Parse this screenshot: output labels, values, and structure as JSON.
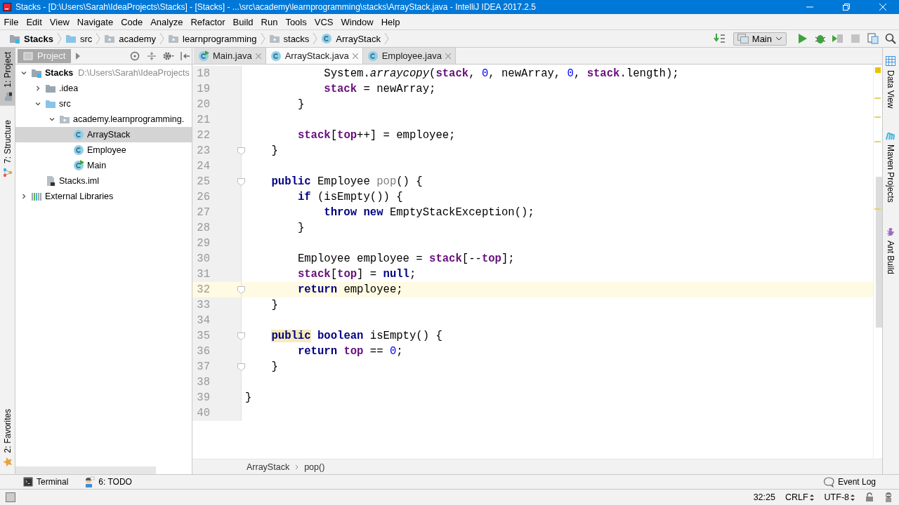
{
  "window": {
    "title": "Stacks - [D:\\Users\\Sarah\\IdeaProjects\\Stacks] - [Stacks] - ...\\src\\academy\\learnprogramming\\stacks\\ArrayStack.java - IntelliJ IDEA 2017.2.5"
  },
  "menu": [
    "File",
    "Edit",
    "View",
    "Navigate",
    "Code",
    "Analyze",
    "Refactor",
    "Build",
    "Run",
    "Tools",
    "VCS",
    "Window",
    "Help"
  ],
  "navigation": {
    "crumbs": [
      {
        "label": "Stacks",
        "kind": "project"
      },
      {
        "label": "src",
        "kind": "source-folder"
      },
      {
        "label": "academy",
        "kind": "package"
      },
      {
        "label": "learnprogramming",
        "kind": "package"
      },
      {
        "label": "stacks",
        "kind": "package"
      },
      {
        "label": "ArrayStack",
        "kind": "class"
      }
    ],
    "run_config": "Main"
  },
  "left_tool_windows": [
    {
      "label": "1: Project",
      "kind": "project",
      "selected": true
    },
    {
      "label": "7: Structure",
      "kind": "structure",
      "selected": false
    }
  ],
  "left_bottom_tool_windows": [
    {
      "label": "2: Favorites",
      "kind": "favorites",
      "selected": false
    }
  ],
  "project_panel": {
    "title": "Project",
    "tree": [
      {
        "label": "Stacks",
        "detail": "D:\\Users\\Sarah\\IdeaProjects",
        "kind": "project",
        "expanded": true,
        "selected": false,
        "children": [
          {
            "label": ".idea",
            "kind": "folder",
            "expanded": false,
            "selected": false
          },
          {
            "label": "src",
            "kind": "source-folder",
            "expanded": true,
            "selected": false,
            "children": [
              {
                "label": "academy.learnprogramming.",
                "kind": "package",
                "expanded": true,
                "selected": false,
                "children": [
                  {
                    "label": "ArrayStack",
                    "kind": "class",
                    "selected": true
                  },
                  {
                    "label": "Employee",
                    "kind": "class",
                    "selected": false
                  },
                  {
                    "label": "Main",
                    "kind": "main-class",
                    "selected": false
                  }
                ]
              }
            ]
          },
          {
            "label": "Stacks.iml",
            "kind": "file",
            "selected": false
          }
        ]
      },
      {
        "label": "External Libraries",
        "kind": "libraries",
        "expanded": false,
        "selected": false
      }
    ]
  },
  "editor": {
    "tabs": [
      {
        "label": "Main.java",
        "kind": "main-class",
        "selected": false
      },
      {
        "label": "ArrayStack.java",
        "kind": "class",
        "selected": true
      },
      {
        "label": "Employee.java",
        "kind": "class",
        "selected": false
      }
    ],
    "lines": [
      {
        "number": "18",
        "current": false,
        "fold": false,
        "tokens": [
          {
            "text": "            System.",
            "kind": "plain"
          },
          {
            "text": "arraycopy",
            "kind": "static"
          },
          {
            "text": "(",
            "kind": "plain"
          },
          {
            "text": "stack",
            "kind": "field"
          },
          {
            "text": ", ",
            "kind": "plain"
          },
          {
            "text": "0",
            "kind": "num"
          },
          {
            "text": ", newArray, ",
            "kind": "plain"
          },
          {
            "text": "0",
            "kind": "num"
          },
          {
            "text": ", ",
            "kind": "plain"
          },
          {
            "text": "stack",
            "kind": "field"
          },
          {
            "text": ".length);",
            "kind": "plain"
          }
        ]
      },
      {
        "number": "19",
        "current": false,
        "fold": false,
        "tokens": [
          {
            "text": "            stack",
            "kind": "field"
          },
          {
            "text": " = newArray;",
            "kind": "plain"
          }
        ]
      },
      {
        "number": "20",
        "current": false,
        "fold": false,
        "tokens": [
          {
            "text": "        }",
            "kind": "plain"
          }
        ]
      },
      {
        "number": "21",
        "current": false,
        "fold": false
      },
      {
        "number": "22",
        "current": false,
        "fold": false,
        "tokens": [
          {
            "text": "        stack",
            "kind": "field"
          },
          {
            "text": "[",
            "kind": "plain"
          },
          {
            "text": "top",
            "kind": "field"
          },
          {
            "text": "++] = employee;",
            "kind": "plain"
          }
        ]
      },
      {
        "number": "23",
        "current": false,
        "fold": true,
        "tokens": [
          {
            "text": "    }",
            "kind": "plain"
          }
        ]
      },
      {
        "number": "24",
        "current": false,
        "fold": false
      },
      {
        "number": "25",
        "current": false,
        "fold": true,
        "tokens": [
          {
            "text": "    public",
            "kind": "kw"
          },
          {
            "text": " Employee ",
            "kind": "plain"
          },
          {
            "text": "pop",
            "kind": "dim"
          },
          {
            "text": "() {",
            "kind": "plain"
          }
        ]
      },
      {
        "number": "26",
        "current": false,
        "fold": false,
        "tokens": [
          {
            "text": "        if",
            "kind": "kw"
          },
          {
            "text": " (isEmpty()) {",
            "kind": "plain"
          }
        ]
      },
      {
        "number": "27",
        "current": false,
        "fold": false,
        "tokens": [
          {
            "text": "            throw new",
            "kind": "kw"
          },
          {
            "text": " EmptyStackException();",
            "kind": "plain"
          }
        ]
      },
      {
        "number": "28",
        "current": false,
        "fold": false,
        "tokens": [
          {
            "text": "        }",
            "kind": "plain"
          }
        ]
      },
      {
        "number": "29",
        "current": false,
        "fold": false
      },
      {
        "number": "30",
        "current": false,
        "fold": false,
        "tokens": [
          {
            "text": "        Employee employee = ",
            "kind": "plain"
          },
          {
            "text": "stack",
            "kind": "field"
          },
          {
            "text": "[--",
            "kind": "plain"
          },
          {
            "text": "top",
            "kind": "field"
          },
          {
            "text": "];",
            "kind": "plain"
          }
        ]
      },
      {
        "number": "31",
        "current": false,
        "fold": false,
        "tokens": [
          {
            "text": "        stack",
            "kind": "field"
          },
          {
            "text": "[",
            "kind": "plain"
          },
          {
            "text": "top",
            "kind": "field"
          },
          {
            "text": "] = ",
            "kind": "plain"
          },
          {
            "text": "null",
            "kind": "kw"
          },
          {
            "text": ";",
            "kind": "plain"
          }
        ]
      },
      {
        "number": "32",
        "current": true,
        "fold": true,
        "tokens": [
          {
            "text": "        return",
            "kind": "kw"
          },
          {
            "text": " employee;",
            "kind": "plain"
          }
        ]
      },
      {
        "number": "33",
        "current": false,
        "fold": false,
        "tokens": [
          {
            "text": "    }",
            "kind": "plain"
          }
        ]
      },
      {
        "number": "34",
        "current": false,
        "fold": false
      },
      {
        "number": "35",
        "current": false,
        "fold": true,
        "tokens": [
          {
            "text": "    public",
            "kind": "kw-hl"
          },
          {
            "text": " boolean",
            "kind": "kw"
          },
          {
            "text": " isEmpty() {",
            "kind": "plain"
          }
        ]
      },
      {
        "number": "36",
        "current": false,
        "fold": false,
        "tokens": [
          {
            "text": "        return ",
            "kind": "kw"
          },
          {
            "text": "top",
            "kind": "field"
          },
          {
            "text": " == ",
            "kind": "plain"
          },
          {
            "text": "0",
            "kind": "num"
          },
          {
            "text": ";",
            "kind": "plain"
          }
        ]
      },
      {
        "number": "37",
        "current": false,
        "fold": true,
        "tokens": [
          {
            "text": "    }",
            "kind": "plain"
          }
        ]
      },
      {
        "number": "38",
        "current": false,
        "fold": false
      },
      {
        "number": "39",
        "current": false,
        "fold": false,
        "tokens": [
          {
            "text": "}",
            "kind": "plain"
          }
        ]
      },
      {
        "number": "40",
        "current": false,
        "fold": false
      }
    ],
    "breadcrumbs": [
      "ArrayStack",
      "pop()"
    ]
  },
  "right_tool_windows": [
    {
      "label": "Data View",
      "kind": "table"
    },
    {
      "label": "Maven Projects",
      "kind": "maven"
    },
    {
      "label": "Ant Build",
      "kind": "ant"
    }
  ],
  "bottom_tool_windows": [
    {
      "label": "Terminal",
      "kind": "terminal"
    },
    {
      "label": "6: TODO",
      "kind": "todo"
    }
  ],
  "event_log": "Event Log",
  "status_bar": {
    "position": "32:25",
    "line_separator": "CRLF",
    "encoding": "UTF-8"
  }
}
